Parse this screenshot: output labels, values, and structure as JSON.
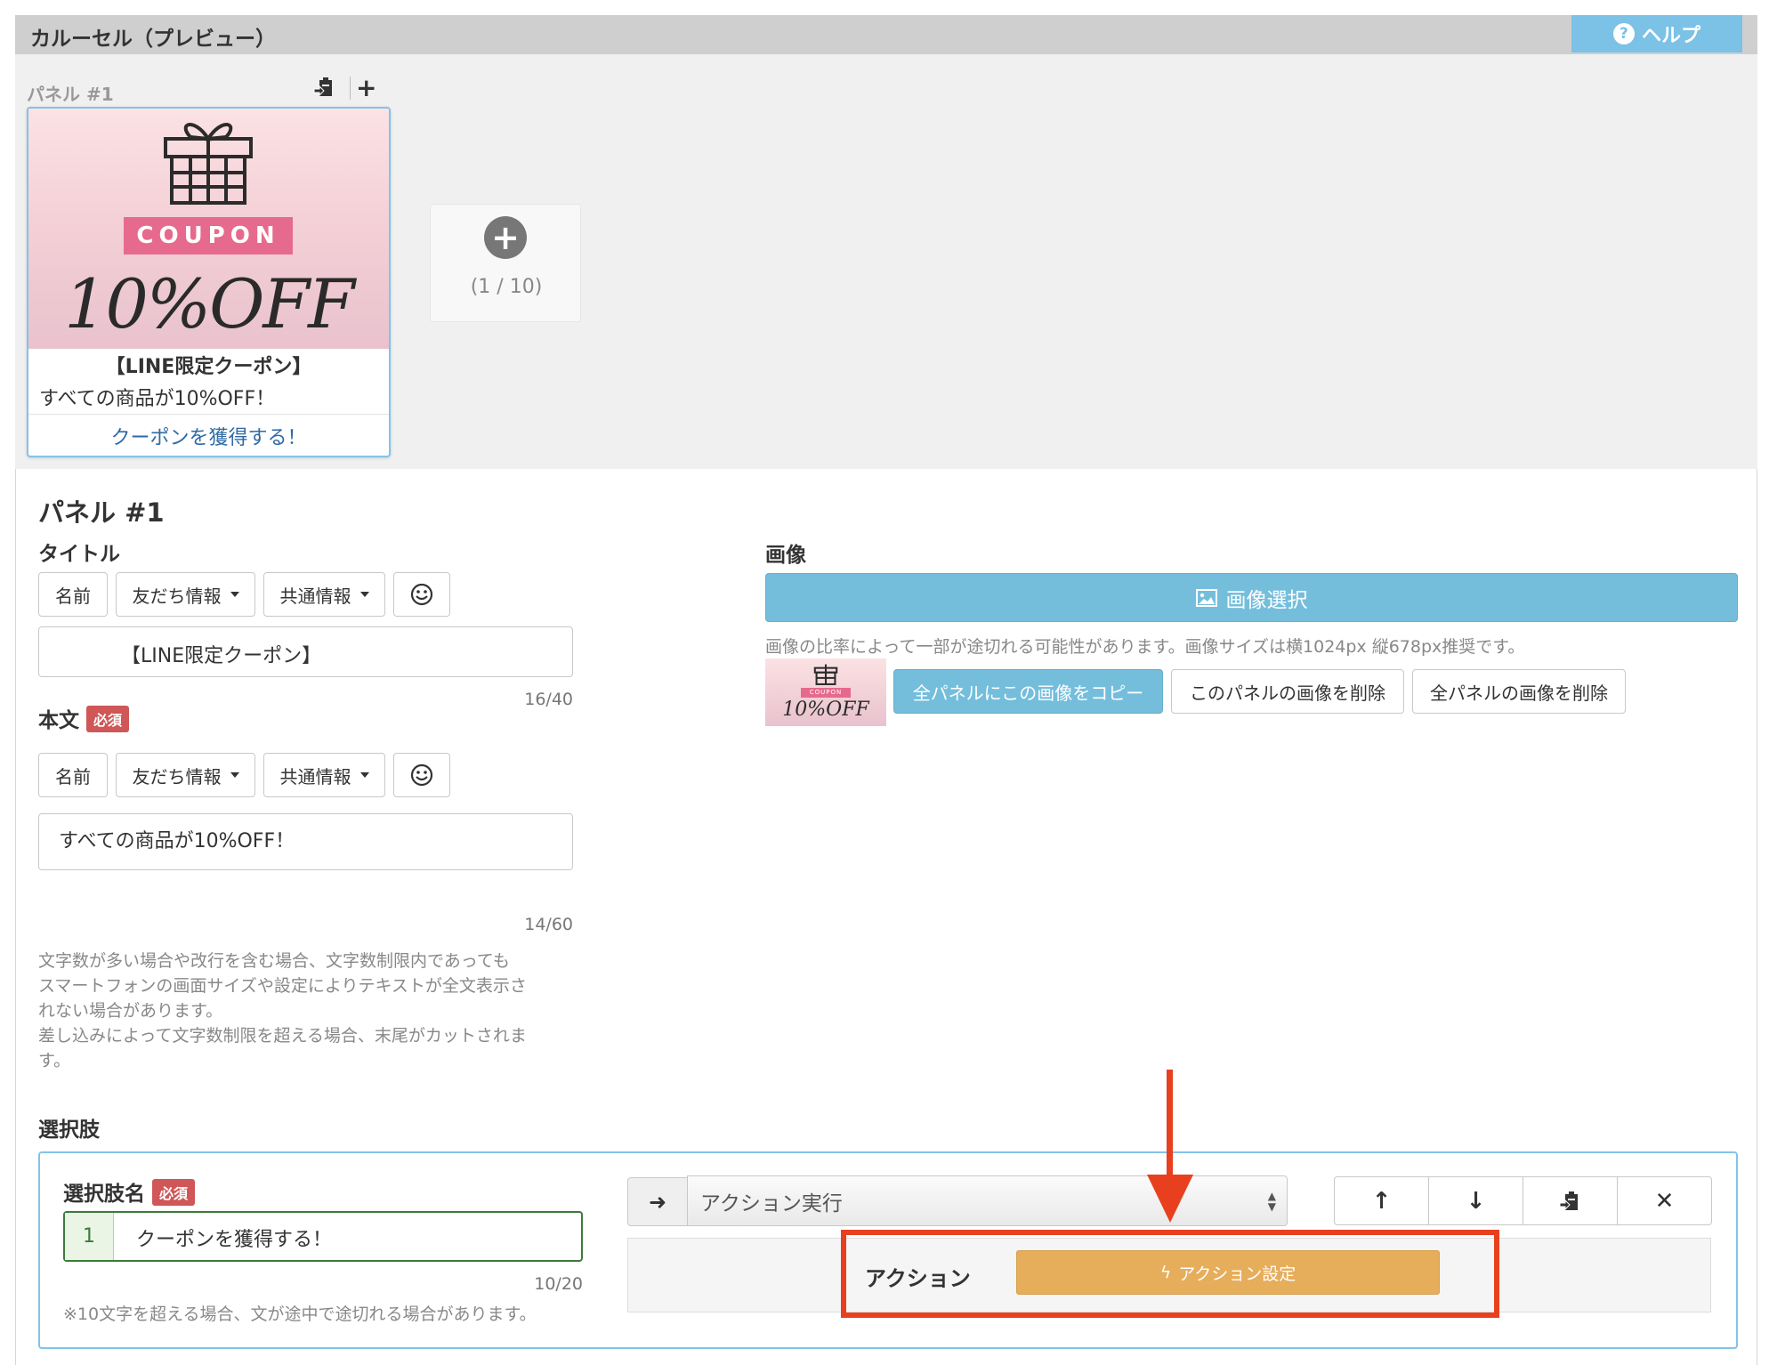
{
  "header": {
    "title": "カルーセル（プレビュー）",
    "help_label": "ヘルプ"
  },
  "preview": {
    "panel_label": "パネル #1",
    "card": {
      "coupon_text": "COUPON",
      "off_text": "10%OFF",
      "title": "【LINE限定クーポン】",
      "body": "すべての商品が10%OFF！",
      "action": "クーポンを獲得する！"
    },
    "add_count": "(1 / 10)"
  },
  "panel": {
    "heading": "パネル #1",
    "title_section": {
      "label": "タイトル",
      "buttons": {
        "name": "名前",
        "friend_info": "友だち情報",
        "common_info": "共通情報"
      },
      "value": "【LINE限定クーポン】",
      "counter": "16/40"
    },
    "body_section": {
      "label": "本文",
      "required": "必須",
      "buttons": {
        "name": "名前",
        "friend_info": "友だち情報",
        "common_info": "共通情報"
      },
      "value": "すべての商品が10%OFF！",
      "counter": "14/60",
      "note_lines": [
        "文字数が多い場合や改行を含む場合、文字数制限内であっても",
        "スマートフォンの画面サイズや設定によりテキストが全文表示さ",
        "れない場合があります。",
        "差し込みによって文字数制限を超える場合、末尾がカットされま",
        "す。"
      ]
    },
    "image_section": {
      "label": "画像",
      "select_button": "画像選択",
      "note": "画像の比率によって一部が途切れる可能性があります。画像サイズは横1024px 縦678px推奨です。",
      "thumb_coupon": "COUPON",
      "thumb_off": "10%OFF",
      "copy_all": "全パネルにこの画像をコピー",
      "delete_this": "このパネルの画像を削除",
      "delete_all": "全パネルの画像を削除"
    }
  },
  "choices": {
    "label": "選択肢",
    "name_label": "選択肢名",
    "required": "必須",
    "item_number": "1",
    "item_value": "クーポンを獲得する！",
    "counter": "10/20",
    "note": "※10文字を超える場合、文が途中で途切れる場合があります。",
    "action_select_value": "アクション実行",
    "action_label": "アクション",
    "action_setting_button": "アクション設定"
  },
  "colors": {
    "accent_blue": "#74bedc",
    "required_red": "#cf5757",
    "action_orange": "#e6ad5b",
    "highlight_red": "#e8401f"
  }
}
